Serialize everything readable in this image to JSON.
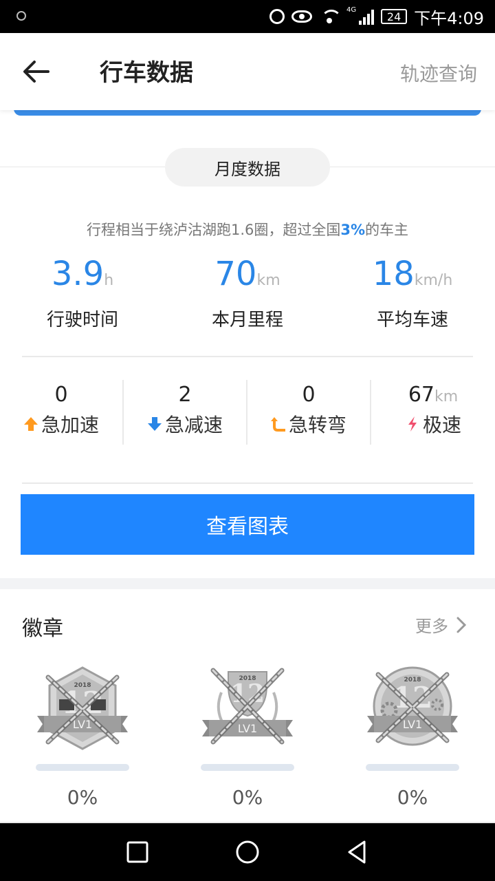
{
  "status_bar": {
    "network": "4G",
    "battery": "24",
    "time": "下午4:09"
  },
  "header": {
    "title": "行车数据",
    "action": "轨迹查询"
  },
  "monthly": {
    "tab_label": "月度数据",
    "summary_prefix": "行程相当于绕泸沽湖跑1.6圈，超过全国",
    "summary_highlight": "3%",
    "summary_suffix": "的车主",
    "stats": [
      {
        "value": "3.9",
        "unit": "h",
        "label": "行驶时间"
      },
      {
        "value": "70",
        "unit": "km",
        "label": "本月里程"
      },
      {
        "value": "18",
        "unit": "km/h",
        "label": "平均车速"
      }
    ],
    "driving": [
      {
        "value": "0",
        "unit": "",
        "label": "急加速",
        "icon": "arrow-up-icon",
        "color": "#ff9a1f"
      },
      {
        "value": "2",
        "unit": "",
        "label": "急减速",
        "icon": "arrow-down-icon",
        "color": "#2a86e6"
      },
      {
        "value": "0",
        "unit": "",
        "label": "急转弯",
        "icon": "turn-icon",
        "color": "#ff9a1f"
      },
      {
        "value": "67",
        "unit": "km",
        "label": "极速",
        "icon": "lightning-icon",
        "color": "#f0506e"
      }
    ],
    "chart_button": "查看图表"
  },
  "badges": {
    "title": "徽章",
    "more": "更多",
    "items": [
      {
        "year": "2018",
        "level": "LV1",
        "progress": 0,
        "percent": "0%"
      },
      {
        "year": "2018",
        "level": "LV1",
        "progress": 0,
        "percent": "0%"
      },
      {
        "year": "2018",
        "level": "LV1",
        "progress": 0,
        "percent": "0%"
      }
    ]
  },
  "colors": {
    "accent": "#1f86ff",
    "value_blue": "#2a86e6",
    "muted": "#9a9a9a"
  }
}
